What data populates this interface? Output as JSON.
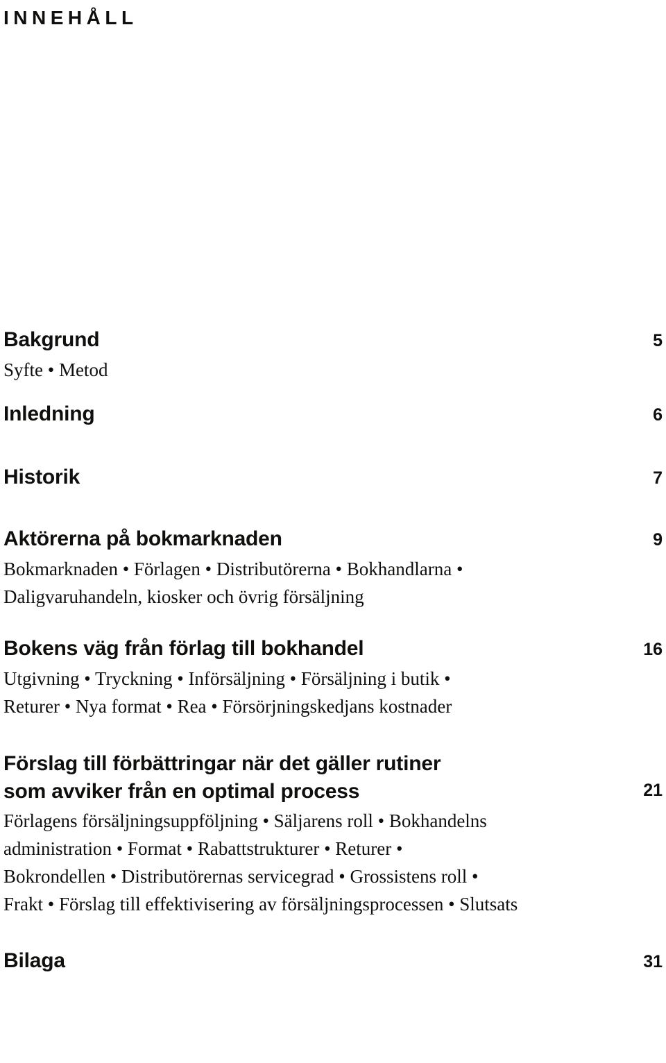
{
  "document": {
    "running_head": "INNEHÅLL",
    "language": "sv",
    "text_color": "#100f0d",
    "background_color": "#ffffff",
    "separator": "•"
  },
  "toc": {
    "entries": [
      {
        "key": "bakgrund",
        "title": "Bakgrund",
        "page": "5",
        "subtitle": "Syfte • Metod"
      },
      {
        "key": "inledning",
        "title": "Inledning",
        "page": "6",
        "subtitle": ""
      },
      {
        "key": "historik",
        "title": "Historik",
        "page": "7",
        "subtitle": ""
      },
      {
        "key": "aktorerna",
        "title": "Aktörerna på bokmarknaden",
        "page": "9",
        "subtitle": "Bokmarknaden • Förlagen • Distributörerna • Bokhandlarna • Daligvaruhandeln, kiosker och övrig försäljning",
        "subtitle_lines": [
          "Bokmarknaden • Förlagen • Distributörerna • Bokhandlarna •",
          "Daligvaruhandeln, kiosker och övrig försäljning"
        ]
      },
      {
        "key": "bokensvag",
        "title": "Bokens väg från förlag till bokhandel",
        "page": "16",
        "subtitle": "Utgivning • Tryckning • Införsäljning • Försäljning i butik • Returer • Nya format • Rea • Försörjningskedjans kostnader",
        "subtitle_lines": [
          "Utgivning • Tryckning • Införsäljning • Försäljning i butik •",
          "Returer • Nya format • Rea • Försörjningskedjans kostnader"
        ]
      },
      {
        "key": "forslag",
        "title": "Förslag till förbättringar när det gäller rutiner\nsom avviker från en optimal process",
        "title_lines": [
          "Förslag till förbättringar när det gäller rutiner",
          "som avviker från en optimal process"
        ],
        "page": "21",
        "subtitle": "Förlagens försäljningsuppföljning • Säljarens roll • Bokhandelns administration • Format • Rabattstrukturer • Returer • Bokrondellen • Distributörernas servicegrad • Grossistens roll • Frakt • Förslag till effektivisering av försäljningsprocessen • Slutsats",
        "subtitle_lines": [
          "Förlagens försäljningsuppföljning • Säljarens roll • Bokhandelns",
          "administration • Format • Rabattstrukturer • Returer •",
          "Bokrondellen • Distributörernas servicegrad • Grossistens roll •",
          "Frakt • Förslag till effektivisering av försäljningsprocessen • Slutsats"
        ]
      },
      {
        "key": "bilaga",
        "title": "Bilaga",
        "page": "31",
        "subtitle": ""
      }
    ]
  }
}
